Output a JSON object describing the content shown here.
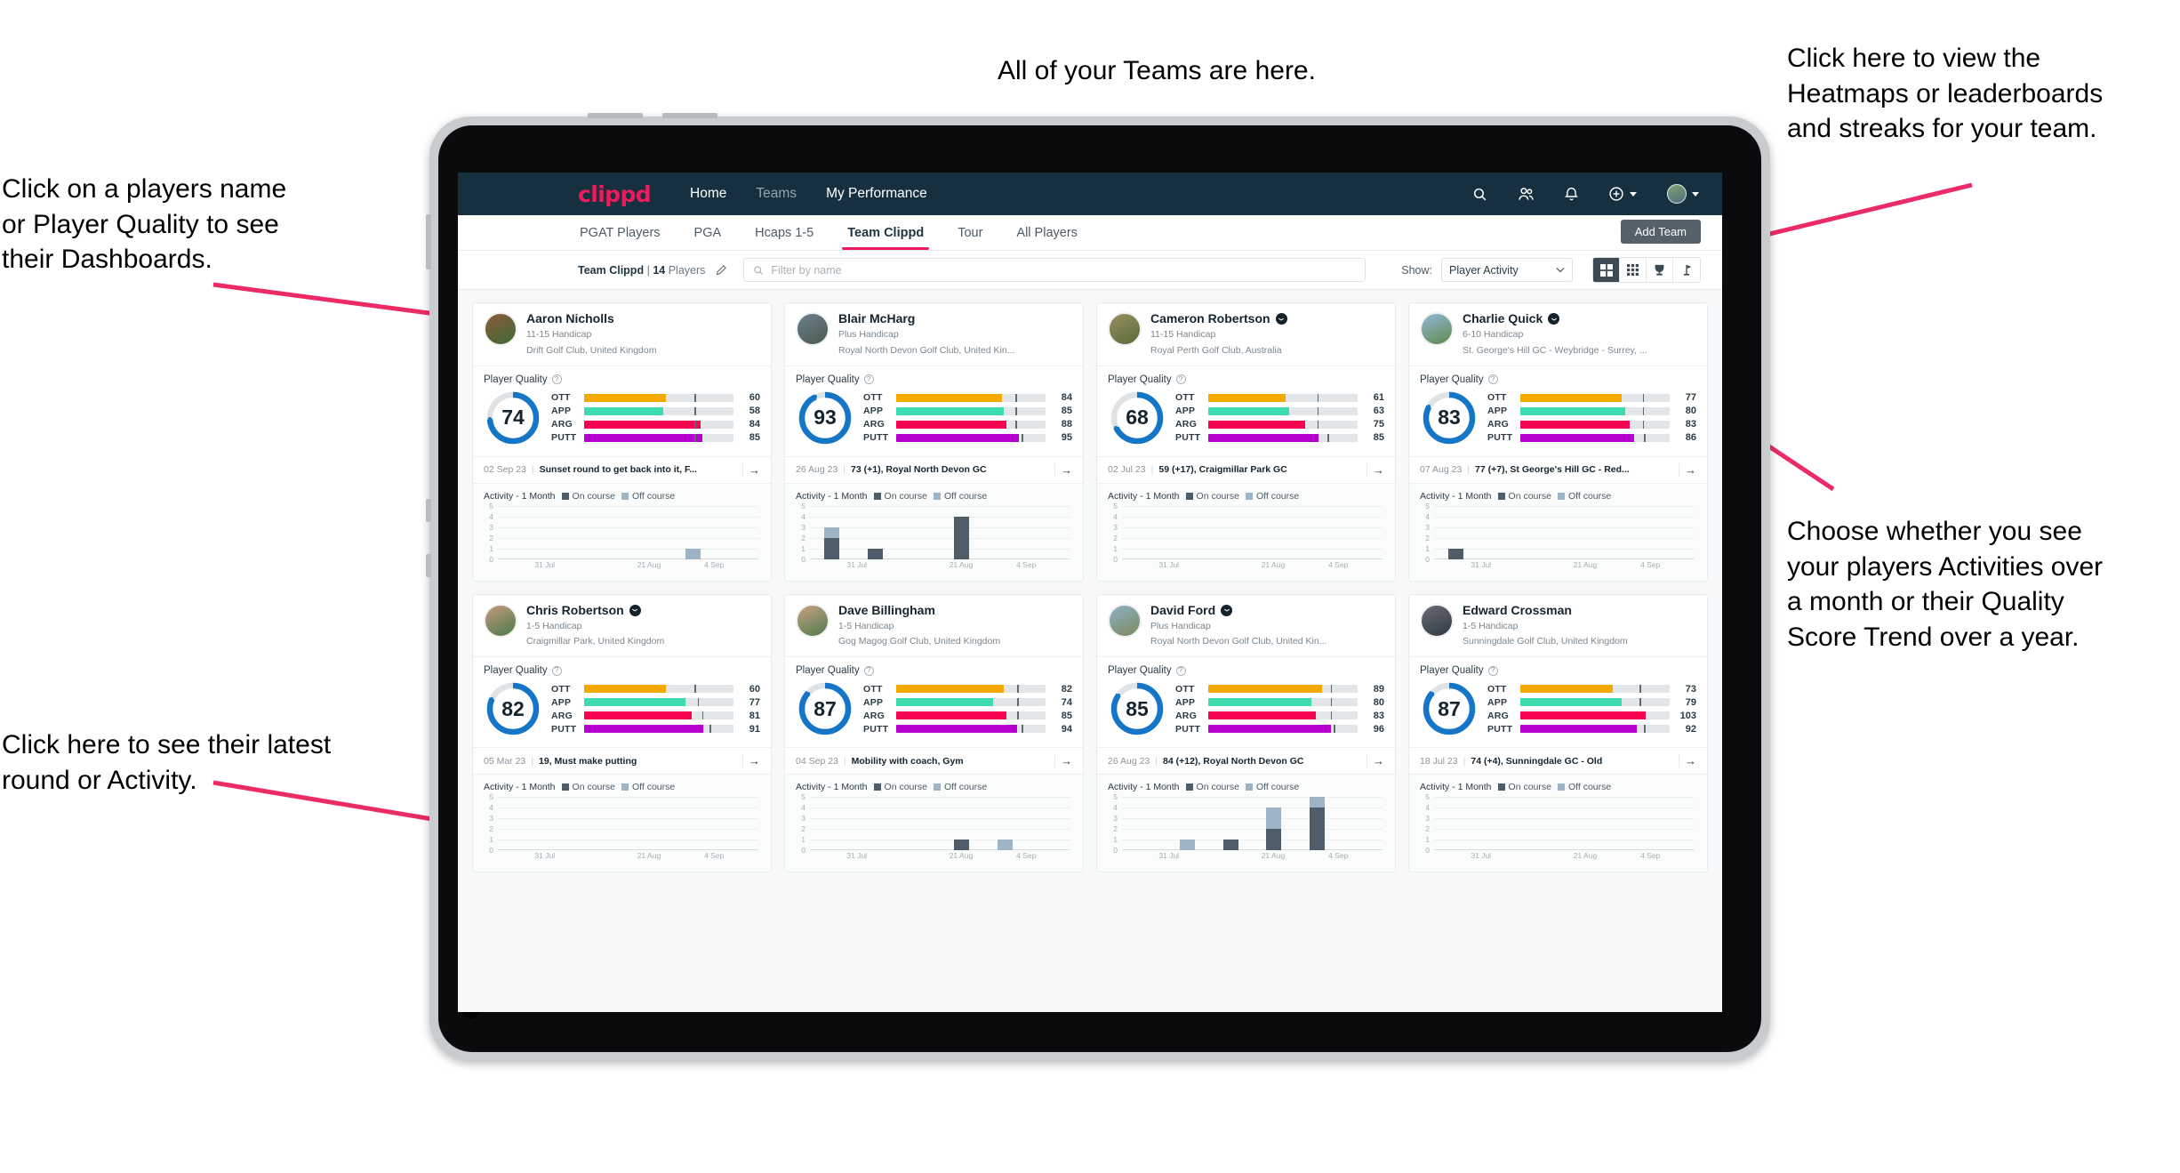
{
  "annotations": [
    {
      "id": "players-name",
      "text": "Click on a players name\nor Player Quality to see\ntheir Dashboards."
    },
    {
      "id": "latest-round",
      "text": "Click here to see their latest\nround or Activity."
    },
    {
      "id": "teams-here",
      "text": "All of your Teams are here."
    },
    {
      "id": "heatmaps",
      "text": "Click here to view the\nHeatmaps or leaderboards\nand streaks for your team."
    },
    {
      "id": "activity-choice",
      "text": "Choose whether you see\nyour players Activities over\na month or their Quality\nScore Trend over a year."
    }
  ],
  "navbar": {
    "logo": "clippd",
    "links": [
      {
        "label": "Home",
        "active": true
      },
      {
        "label": "Teams",
        "active": false
      },
      {
        "label": "My Performance",
        "active": true
      }
    ],
    "icons": [
      "search-icon",
      "people-icon",
      "bell-icon",
      "plus-circle-icon",
      "avatar"
    ]
  },
  "tabs": [
    {
      "label": "PGAT Players",
      "active": false
    },
    {
      "label": "PGA",
      "active": false
    },
    {
      "label": "Hcaps 1-5",
      "active": false
    },
    {
      "label": "Team Clippd",
      "active": true
    },
    {
      "label": "Tour",
      "active": false
    },
    {
      "label": "All Players",
      "active": false
    }
  ],
  "add_team_label": "Add Team",
  "toolbar": {
    "team_name": "Team Clippd",
    "separator": "|",
    "player_count": "14",
    "players_word": "Players",
    "edit_icon": "pencil-icon",
    "search_placeholder": "Filter by name",
    "search_value": "",
    "show_label": "Show:",
    "show_value": "Player Activity",
    "show_options": [
      "Player Activity",
      "Quality Score Trend"
    ],
    "view_toggles": [
      {
        "name": "grid-view",
        "icon": "grid-large-icon",
        "active": true
      },
      {
        "name": "dense-view",
        "icon": "grid-small-icon",
        "active": false
      },
      {
        "name": "leaderboard-view",
        "icon": "trophy-icon",
        "active": false
      },
      {
        "name": "streaks-view",
        "icon": "flag-icon",
        "active": false
      }
    ]
  },
  "card_labels": {
    "player_quality": "Player Quality",
    "help_icon": "question-circle-icon",
    "activity_title": "Activity - 1 Month",
    "legend_on": "On course",
    "legend_off": "Off course",
    "arrow_icon": "arrow-right-icon"
  },
  "colors": {
    "brand_pink": "#ec1c5c",
    "navbar": "#16303f",
    "ring": "#1575c6",
    "ring_track": "#dfe3e6",
    "ott": "#f5a800",
    "app": "#3ddcb0",
    "arg": "#f5054f",
    "putt": "#b500cf",
    "on_course": "#4e5d69",
    "off_course": "#9db3c6",
    "annotation_arrow": "#ec2a66"
  },
  "chart_axis": {
    "y_ticks": [
      "5",
      "4",
      "3",
      "2",
      "1",
      "0"
    ],
    "y_max": 5,
    "x_ticks": [
      "31 Jul",
      "21 Aug",
      "4 Sep"
    ]
  },
  "players": [
    {
      "name": "Aaron Nicholls",
      "verified": false,
      "handicap": "11-15 Handicap",
      "club": "Drift Golf Club, United Kingdom",
      "avatar_colors": [
        "#8a5a3c",
        "#3f6b35"
      ],
      "quality_score": 74,
      "metrics": [
        {
          "label": "OTT",
          "value": 60,
          "fill": 55,
          "tick": 74
        },
        {
          "label": "APP",
          "value": 58,
          "fill": 53,
          "tick": 74
        },
        {
          "label": "ARG",
          "value": 84,
          "fill": 78,
          "tick": 74
        },
        {
          "label": "PUTT",
          "value": 85,
          "fill": 79,
          "tick": 74
        }
      ],
      "last_date": "02 Sep 23",
      "last_text": "Sunset round to get back into it, F...",
      "activity": [
        {
          "on": 0,
          "off": 0
        },
        {
          "on": 0,
          "off": 0
        },
        {
          "on": 0,
          "off": 0
        },
        {
          "on": 0,
          "off": 0
        },
        {
          "on": 0,
          "off": 1
        },
        {
          "on": 0,
          "off": 0
        }
      ]
    },
    {
      "name": "Blair McHarg",
      "verified": false,
      "handicap": "Plus Handicap",
      "club": "Royal North Devon Golf Club, United Kin...",
      "avatar_colors": [
        "#6d7f8c",
        "#4a5a50"
      ],
      "quality_score": 93,
      "metrics": [
        {
          "label": "OTT",
          "value": 84,
          "fill": 71,
          "tick": 80
        },
        {
          "label": "APP",
          "value": 85,
          "fill": 72,
          "tick": 80
        },
        {
          "label": "ARG",
          "value": 88,
          "fill": 74,
          "tick": 80
        },
        {
          "label": "PUTT",
          "value": 95,
          "fill": 82,
          "tick": 84
        }
      ],
      "last_date": "26 Aug 23",
      "last_text": "73 (+1), Royal North Devon GC",
      "activity": [
        {
          "on": 2,
          "off": 1
        },
        {
          "on": 1,
          "off": 0
        },
        {
          "on": 0,
          "off": 0
        },
        {
          "on": 4,
          "off": 0
        },
        {
          "on": 0,
          "off": 0
        },
        {
          "on": 0,
          "off": 0
        }
      ]
    },
    {
      "name": "Cameron Robertson",
      "verified": true,
      "handicap": "11-15 Handicap",
      "club": "Royal Perth Golf Club, Australia",
      "avatar_colors": [
        "#9a8f5e",
        "#556b3a"
      ],
      "quality_score": 68,
      "metrics": [
        {
          "label": "OTT",
          "value": 61,
          "fill": 52,
          "tick": 73
        },
        {
          "label": "APP",
          "value": 63,
          "fill": 54,
          "tick": 73
        },
        {
          "label": "ARG",
          "value": 75,
          "fill": 65,
          "tick": 73
        },
        {
          "label": "PUTT",
          "value": 85,
          "fill": 74,
          "tick": 80
        }
      ],
      "last_date": "02 Jul 23",
      "last_text": "59 (+17), Craigmillar Park GC",
      "activity": [
        {
          "on": 0,
          "off": 0
        },
        {
          "on": 0,
          "off": 0
        },
        {
          "on": 0,
          "off": 0
        },
        {
          "on": 0,
          "off": 0
        },
        {
          "on": 0,
          "off": 0
        },
        {
          "on": 0,
          "off": 0
        }
      ]
    },
    {
      "name": "Charlie Quick",
      "verified": true,
      "handicap": "6-10 Handicap",
      "club": "St. George's Hill GC - Weybridge - Surrey, ...",
      "avatar_colors": [
        "#8fb8d8",
        "#5f8a4a"
      ],
      "quality_score": 83,
      "metrics": [
        {
          "label": "OTT",
          "value": 77,
          "fill": 68,
          "tick": 82
        },
        {
          "label": "APP",
          "value": 80,
          "fill": 70,
          "tick": 82
        },
        {
          "label": "ARG",
          "value": 83,
          "fill": 73,
          "tick": 82
        },
        {
          "label": "PUTT",
          "value": 86,
          "fill": 76,
          "tick": 83
        }
      ],
      "last_date": "07 Aug 23",
      "last_text": "77 (+7), St George's Hill GC - Red...",
      "activity": [
        {
          "on": 1,
          "off": 0
        },
        {
          "on": 0,
          "off": 0
        },
        {
          "on": 0,
          "off": 0
        },
        {
          "on": 0,
          "off": 0
        },
        {
          "on": 0,
          "off": 0
        },
        {
          "on": 0,
          "off": 0
        }
      ]
    },
    {
      "name": "Chris Robertson",
      "verified": true,
      "handicap": "1-5 Handicap",
      "club": "Craigmillar Park, United Kingdom",
      "avatar_colors": [
        "#c49a80",
        "#4a7a46"
      ],
      "quality_score": 82,
      "metrics": [
        {
          "label": "OTT",
          "value": 60,
          "fill": 55,
          "tick": 74
        },
        {
          "label": "APP",
          "value": 77,
          "fill": 68,
          "tick": 76
        },
        {
          "label": "ARG",
          "value": 81,
          "fill": 72,
          "tick": 79
        },
        {
          "label": "PUTT",
          "value": 91,
          "fill": 80,
          "tick": 84
        }
      ],
      "last_date": "05 Mar 23",
      "last_text": "19, Must make putting",
      "activity": [
        {
          "on": 0,
          "off": 0
        },
        {
          "on": 0,
          "off": 0
        },
        {
          "on": 0,
          "off": 0
        },
        {
          "on": 0,
          "off": 0
        },
        {
          "on": 0,
          "off": 0
        },
        {
          "on": 0,
          "off": 0
        }
      ]
    },
    {
      "name": "Dave Billingham",
      "verified": false,
      "handicap": "1-5 Handicap",
      "club": "Gog Magog Golf Club, United Kingdom",
      "avatar_colors": [
        "#c9a184",
        "#4c7c4c"
      ],
      "quality_score": 87,
      "metrics": [
        {
          "label": "OTT",
          "value": 82,
          "fill": 72,
          "tick": 81
        },
        {
          "label": "APP",
          "value": 74,
          "fill": 65,
          "tick": 81
        },
        {
          "label": "ARG",
          "value": 85,
          "fill": 74,
          "tick": 81
        },
        {
          "label": "PUTT",
          "value": 94,
          "fill": 81,
          "tick": 84
        }
      ],
      "last_date": "04 Sep 23",
      "last_text": "Mobility with coach, Gym",
      "activity": [
        {
          "on": 0,
          "off": 0
        },
        {
          "on": 0,
          "off": 0
        },
        {
          "on": 0,
          "off": 0
        },
        {
          "on": 1,
          "off": 0
        },
        {
          "on": 0,
          "off": 1
        },
        {
          "on": 0,
          "off": 0
        }
      ]
    },
    {
      "name": "David Ford",
      "verified": true,
      "handicap": "Plus Handicap",
      "club": "Royal North Devon Golf Club, United Kin...",
      "avatar_colors": [
        "#8fb0c8",
        "#7a8a5c"
      ],
      "quality_score": 85,
      "metrics": [
        {
          "label": "OTT",
          "value": 89,
          "fill": 76,
          "tick": 82
        },
        {
          "label": "APP",
          "value": 80,
          "fill": 69,
          "tick": 82
        },
        {
          "label": "ARG",
          "value": 83,
          "fill": 72,
          "tick": 82
        },
        {
          "label": "PUTT",
          "value": 96,
          "fill": 82,
          "tick": 84
        }
      ],
      "last_date": "26 Aug 23",
      "last_text": "84 (+12), Royal North Devon GC",
      "activity": [
        {
          "on": 0,
          "off": 0
        },
        {
          "on": 0,
          "off": 1
        },
        {
          "on": 1,
          "off": 0
        },
        {
          "on": 2,
          "off": 2
        },
        {
          "on": 4,
          "off": 1
        },
        {
          "on": 0,
          "off": 0
        }
      ]
    },
    {
      "name": "Edward Crossman",
      "verified": false,
      "handicap": "1-5 Handicap",
      "club": "Sunningdale Golf Club, United Kingdom",
      "avatar_colors": [
        "#6b6b73",
        "#2f3a44"
      ],
      "quality_score": 87,
      "metrics": [
        {
          "label": "OTT",
          "value": 73,
          "fill": 62,
          "tick": 80
        },
        {
          "label": "APP",
          "value": 79,
          "fill": 68,
          "tick": 80
        },
        {
          "label": "ARG",
          "value": 103,
          "fill": 84,
          "tick": 0
        },
        {
          "label": "PUTT",
          "value": 92,
          "fill": 78,
          "tick": 83
        }
      ],
      "last_date": "18 Jul 23",
      "last_text": "74 (+4), Sunningdale GC - Old",
      "activity": [
        {
          "on": 0,
          "off": 0
        },
        {
          "on": 0,
          "off": 0
        },
        {
          "on": 0,
          "off": 0
        },
        {
          "on": 0,
          "off": 0
        },
        {
          "on": 0,
          "off": 0
        },
        {
          "on": 0,
          "off": 0
        }
      ]
    }
  ]
}
